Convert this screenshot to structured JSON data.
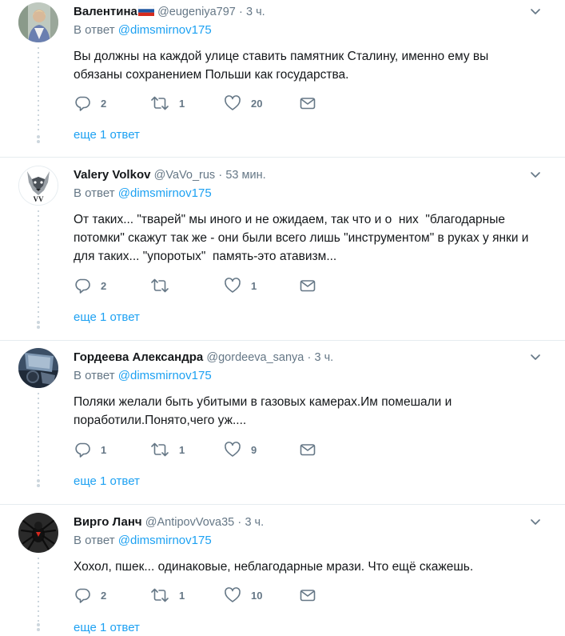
{
  "tweets": [
    {
      "name": "Валентина",
      "handle": "@eugeniya797",
      "separator": "·",
      "time": "3 ч.",
      "reply_prefix": "В ответ",
      "reply_to": "@dimsmirnov175",
      "text": "Вы должны на каждой улице ставить памятник Сталину, именно ему вы обязаны сохранением Польши как государства.",
      "replies": "2",
      "retweets": "1",
      "likes": "20",
      "more_replies": "еще 1 ответ"
    },
    {
      "name": "Valery Volkov",
      "handle": "@VaVo_rus",
      "separator": "·",
      "time": "53 мин.",
      "reply_prefix": "В ответ",
      "reply_to": "@dimsmirnov175",
      "text": "От таких... \"тварей\" мы иного и не ожидаем, так что и о  них  \"благодарные потомки\" скажут так же - они были всего лишь \"инструментом\" в руках у янки и  для таких... \"упоротых\"  память-это атавизм...",
      "replies": "2",
      "retweets": "",
      "likes": "1",
      "more_replies": "еще 1 ответ"
    },
    {
      "name": "Гордеева Александра",
      "handle": "@gordeeva_sanya",
      "separator": "·",
      "time": "3 ч.",
      "reply_prefix": "В ответ",
      "reply_to": "@dimsmirnov175",
      "text": "Поляки желали быть убитыми в газовых камерах.Им помешали и поработили.Понято,чего уж....",
      "replies": "1",
      "retweets": "1",
      "likes": "9",
      "more_replies": "еще 1 ответ"
    },
    {
      "name": "Вирго Ланч",
      "handle": "@AntipovVova35",
      "separator": "·",
      "time": "3 ч.",
      "reply_prefix": "В ответ",
      "reply_to": "@dimsmirnov175",
      "text": "Хохол, пшек... одинаковые, неблагодарные мрази. Что ещё скажешь.",
      "replies": "2",
      "retweets": "1",
      "likes": "10",
      "more_replies": "еще 1 ответ"
    }
  ],
  "colors": {
    "link": "#1da1f2",
    "muted": "#657786",
    "text": "#14171a",
    "border": "#e6ecf0"
  },
  "icons": [
    "reply-icon",
    "retweet-icon",
    "like-icon",
    "direct-message-icon",
    "chevron-down-icon",
    "russia-flag-icon"
  ]
}
